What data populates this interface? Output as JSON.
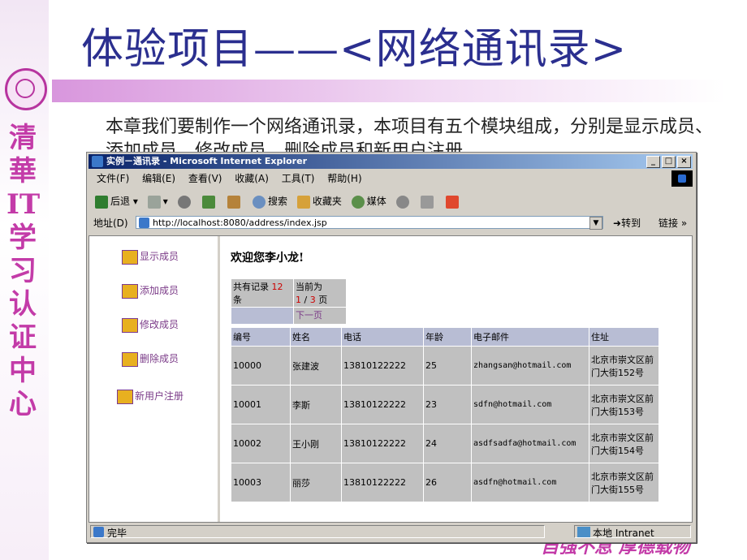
{
  "slide": {
    "title": "体验项目——<网络通讯录>",
    "paragraph": "本章我们要制作一个网络通讯录，本项目有五个模块组成，分别是显示成员、添加成员、修改成员、删除成员和新用户注册。",
    "vertical_text": "清華IT学习认证中心",
    "slogan": "自强不息 厚德载物"
  },
  "browser": {
    "title": "实例－通讯录 - Microsoft Internet Explorer",
    "menu": [
      "文件(F)",
      "编辑(E)",
      "查看(V)",
      "收藏(A)",
      "工具(T)",
      "帮助(H)"
    ],
    "toolbar": {
      "back": "后退",
      "search": "搜索",
      "favorites": "收藏夹",
      "media": "媒体"
    },
    "address": {
      "label": "地址(D)",
      "url": "http://localhost:8080/address/index.jsp",
      "go": "转到",
      "links": "链接"
    },
    "status": {
      "left": "完毕",
      "right": "本地 Intranet"
    }
  },
  "nav": [
    "显示成员",
    "添加成员",
    "修改成员",
    "删除成员",
    "新用户注册"
  ],
  "page": {
    "welcome": "欢迎您李小龙!",
    "pager": {
      "total_prefix": "共有记录",
      "total": "12",
      "total_suffix": "条",
      "current_prefix": "当前为",
      "current": "1",
      "sep": "/",
      "pages": "3",
      "page_suffix": "页",
      "next": "下一页"
    },
    "columns": [
      "编号",
      "姓名",
      "电话",
      "年龄",
      "电子邮件",
      "住址"
    ],
    "rows": [
      {
        "id": "10000",
        "name": "张建波",
        "phone": "13810122222",
        "age": "25",
        "email": "zhangsan@hotmail.com",
        "address": "北京市崇文区前门大街152号"
      },
      {
        "id": "10001",
        "name": "李斯",
        "phone": "13810122222",
        "age": "23",
        "email": "sdfn@hotmail.com",
        "address": "北京市崇文区前门大街153号"
      },
      {
        "id": "10002",
        "name": "王小刚",
        "phone": "13810122222",
        "age": "24",
        "email": "asdfsadfa@hotmail.com",
        "address": "北京市崇文区前门大街154号"
      },
      {
        "id": "10003",
        "name": "丽莎",
        "phone": "13810122222",
        "age": "26",
        "email": "asdfn@hotmail.com",
        "address": "北京市崇文区前门大街155号"
      }
    ]
  }
}
